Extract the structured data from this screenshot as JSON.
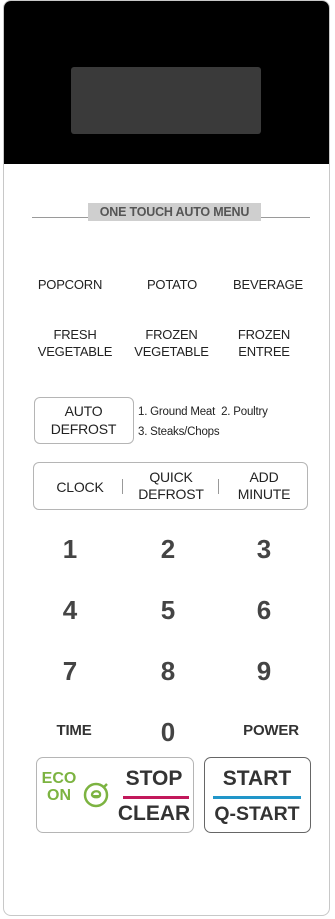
{
  "menu_header": "ONE TOUCH AUTO MENU",
  "auto_menu": {
    "popcorn": "POPCORN",
    "potato": "POTATO",
    "beverage": "BEVERAGE",
    "fresh_vegetable_1": "FRESH",
    "fresh_vegetable_2": "VEGETABLE",
    "frozen_vegetable_1": "FROZEN",
    "frozen_vegetable_2": "VEGETABLE",
    "frozen_entree_1": "FROZEN",
    "frozen_entree_2": "ENTREE"
  },
  "auto_defrost": {
    "label_1": "AUTO",
    "label_2": "DEFROST",
    "options_line_1": "1. Ground Meat  2. Poultry",
    "options_line_2": "3. Steaks/Chops"
  },
  "function_row": {
    "clock": "CLOCK",
    "quick_defrost_1": "QUICK",
    "quick_defrost_2": "DEFROST",
    "add_minute_1": "ADD",
    "add_minute_2": "MINUTE"
  },
  "keypad": {
    "k1": "1",
    "k2": "2",
    "k3": "3",
    "k4": "4",
    "k5": "5",
    "k6": "6",
    "k7": "7",
    "k8": "8",
    "k9": "9",
    "k0": "0",
    "time": "TIME",
    "power": "POWER"
  },
  "controls": {
    "eco_1": "ECO",
    "eco_2": "ON",
    "stop": "STOP",
    "clear": "CLEAR",
    "start": "START",
    "q_start": "Q-START"
  },
  "colors": {
    "eco_green": "#7cb341",
    "stop_line": "#c2185b",
    "start_line": "#2196c9"
  },
  "icons": [
    "eco-leaf-icon"
  ]
}
